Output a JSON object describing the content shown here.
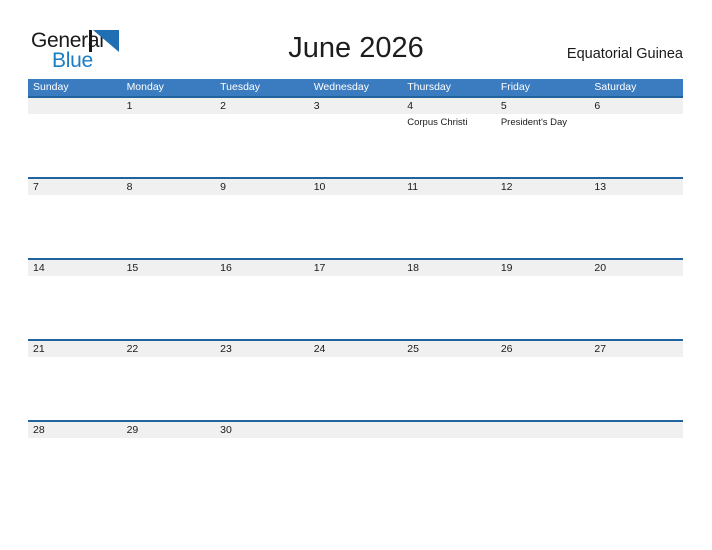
{
  "brand": {
    "name_part1": "General",
    "name_part2": "Blue",
    "logo_icon": "triangle-flag-icon",
    "primary_color": "#1b7dc4",
    "dark_color": "#17181a"
  },
  "header": {
    "title": "June 2026",
    "region": "Equatorial Guinea"
  },
  "calendar": {
    "header_bg": "#3b7cc0",
    "band_bg": "#f0f0f0",
    "band_border": "#20639f",
    "weekdays": [
      "Sunday",
      "Monday",
      "Tuesday",
      "Wednesday",
      "Thursday",
      "Friday",
      "Saturday"
    ],
    "weeks": [
      {
        "days": [
          {
            "number": "",
            "events": []
          },
          {
            "number": "1",
            "events": []
          },
          {
            "number": "2",
            "events": []
          },
          {
            "number": "3",
            "events": []
          },
          {
            "number": "4",
            "events": [
              "Corpus Christi"
            ]
          },
          {
            "number": "5",
            "events": [
              "President's Day"
            ]
          },
          {
            "number": "6",
            "events": []
          }
        ]
      },
      {
        "days": [
          {
            "number": "7",
            "events": []
          },
          {
            "number": "8",
            "events": []
          },
          {
            "number": "9",
            "events": []
          },
          {
            "number": "10",
            "events": []
          },
          {
            "number": "11",
            "events": []
          },
          {
            "number": "12",
            "events": []
          },
          {
            "number": "13",
            "events": []
          }
        ]
      },
      {
        "days": [
          {
            "number": "14",
            "events": []
          },
          {
            "number": "15",
            "events": []
          },
          {
            "number": "16",
            "events": []
          },
          {
            "number": "17",
            "events": []
          },
          {
            "number": "18",
            "events": []
          },
          {
            "number": "19",
            "events": []
          },
          {
            "number": "20",
            "events": []
          }
        ]
      },
      {
        "days": [
          {
            "number": "21",
            "events": []
          },
          {
            "number": "22",
            "events": []
          },
          {
            "number": "23",
            "events": []
          },
          {
            "number": "24",
            "events": []
          },
          {
            "number": "25",
            "events": []
          },
          {
            "number": "26",
            "events": []
          },
          {
            "number": "27",
            "events": []
          }
        ]
      },
      {
        "days": [
          {
            "number": "28",
            "events": []
          },
          {
            "number": "29",
            "events": []
          },
          {
            "number": "30",
            "events": []
          },
          {
            "number": "",
            "events": []
          },
          {
            "number": "",
            "events": []
          },
          {
            "number": "",
            "events": []
          },
          {
            "number": "",
            "events": []
          }
        ]
      }
    ]
  }
}
